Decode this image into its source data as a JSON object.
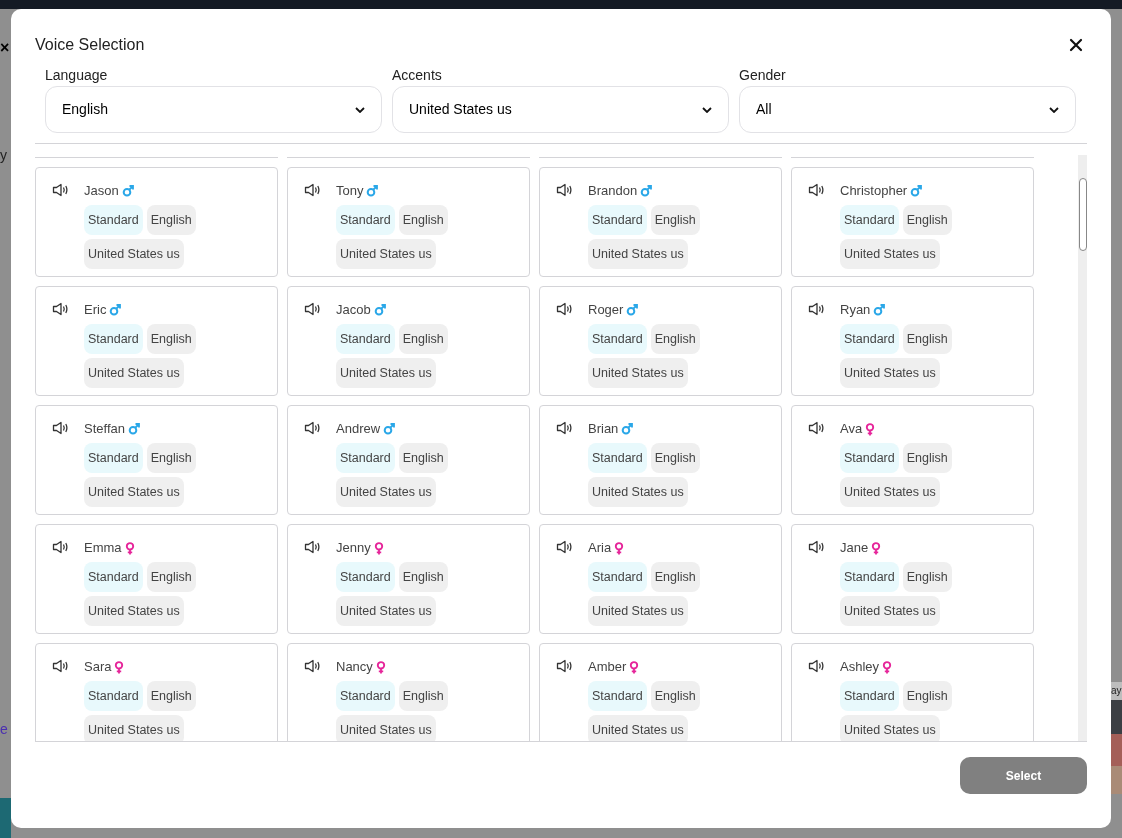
{
  "background": {
    "left_texts": [
      "×",
      "y",
      "e"
    ],
    "right_texts": [
      "ay"
    ]
  },
  "dialog": {
    "title": "Voice Selection"
  },
  "filters": [
    {
      "label": "Language",
      "value": "English"
    },
    {
      "label": "Accents",
      "value": "United States us"
    },
    {
      "label": "Gender",
      "value": "All"
    }
  ],
  "voices": [
    {
      "name": "Jason",
      "kind": "male",
      "tags": [
        {
          "kind": "model",
          "text": "Standard"
        },
        {
          "kind": "info",
          "text": "English"
        },
        {
          "kind": "info",
          "text": "United States us"
        }
      ]
    },
    {
      "name": "Tony",
      "kind": "male",
      "tags": [
        {
          "kind": "model",
          "text": "Standard"
        },
        {
          "kind": "info",
          "text": "English"
        },
        {
          "kind": "info",
          "text": "United States us"
        }
      ]
    },
    {
      "name": "Brandon",
      "kind": "male",
      "tags": [
        {
          "kind": "model",
          "text": "Standard"
        },
        {
          "kind": "info",
          "text": "English"
        },
        {
          "kind": "info",
          "text": "United States us"
        }
      ]
    },
    {
      "name": "Christopher",
      "kind": "male",
      "tags": [
        {
          "kind": "model",
          "text": "Standard"
        },
        {
          "kind": "info",
          "text": "English"
        },
        {
          "kind": "info",
          "text": "United States us"
        }
      ]
    },
    {
      "name": "Eric",
      "kind": "male",
      "tags": [
        {
          "kind": "model",
          "text": "Standard"
        },
        {
          "kind": "info",
          "text": "English"
        },
        {
          "kind": "info",
          "text": "United States us"
        }
      ]
    },
    {
      "name": "Jacob",
      "kind": "male",
      "tags": [
        {
          "kind": "model",
          "text": "Standard"
        },
        {
          "kind": "info",
          "text": "English"
        },
        {
          "kind": "info",
          "text": "United States us"
        }
      ]
    },
    {
      "name": "Roger",
      "kind": "male",
      "tags": [
        {
          "kind": "model",
          "text": "Standard"
        },
        {
          "kind": "info",
          "text": "English"
        },
        {
          "kind": "info",
          "text": "United States us"
        }
      ]
    },
    {
      "name": "Ryan",
      "kind": "male",
      "tags": [
        {
          "kind": "model",
          "text": "Standard"
        },
        {
          "kind": "info",
          "text": "English"
        },
        {
          "kind": "info",
          "text": "United States us"
        }
      ]
    },
    {
      "name": "Steffan",
      "kind": "male",
      "tags": [
        {
          "kind": "model",
          "text": "Standard"
        },
        {
          "kind": "info",
          "text": "English"
        },
        {
          "kind": "info",
          "text": "United States us"
        }
      ]
    },
    {
      "name": "Andrew",
      "kind": "male",
      "tags": [
        {
          "kind": "model",
          "text": "Standard"
        },
        {
          "kind": "info",
          "text": "English"
        },
        {
          "kind": "info",
          "text": "United States us"
        }
      ]
    },
    {
      "name": "Brian",
      "kind": "male",
      "tags": [
        {
          "kind": "model",
          "text": "Standard"
        },
        {
          "kind": "info",
          "text": "English"
        },
        {
          "kind": "info",
          "text": "United States us"
        }
      ]
    },
    {
      "name": "Ava",
      "kind": "female",
      "tags": [
        {
          "kind": "model",
          "text": "Standard"
        },
        {
          "kind": "info",
          "text": "English"
        },
        {
          "kind": "info",
          "text": "United States us"
        }
      ]
    },
    {
      "name": "Emma",
      "kind": "female",
      "tags": [
        {
          "kind": "model",
          "text": "Standard"
        },
        {
          "kind": "info",
          "text": "English"
        },
        {
          "kind": "info",
          "text": "United States us"
        }
      ]
    },
    {
      "name": "Jenny",
      "kind": "female",
      "tags": [
        {
          "kind": "model",
          "text": "Standard"
        },
        {
          "kind": "info",
          "text": "English"
        },
        {
          "kind": "info",
          "text": "United States us"
        }
      ]
    },
    {
      "name": "Aria",
      "kind": "female",
      "tags": [
        {
          "kind": "model",
          "text": "Standard"
        },
        {
          "kind": "info",
          "text": "English"
        },
        {
          "kind": "info",
          "text": "United States us"
        }
      ]
    },
    {
      "name": "Jane",
      "kind": "female",
      "tags": [
        {
          "kind": "model",
          "text": "Standard"
        },
        {
          "kind": "info",
          "text": "English"
        },
        {
          "kind": "info",
          "text": "United States us"
        }
      ]
    },
    {
      "name": "Sara",
      "kind": "female",
      "tags": [
        {
          "kind": "model",
          "text": "Standard"
        },
        {
          "kind": "info",
          "text": "English"
        },
        {
          "kind": "info",
          "text": "United States us"
        }
      ]
    },
    {
      "name": "Nancy",
      "kind": "female",
      "tags": [
        {
          "kind": "model",
          "text": "Standard"
        },
        {
          "kind": "info",
          "text": "English"
        },
        {
          "kind": "info",
          "text": "United States us"
        }
      ]
    },
    {
      "name": "Amber",
      "kind": "female",
      "tags": [
        {
          "kind": "model",
          "text": "Standard"
        },
        {
          "kind": "info",
          "text": "English"
        },
        {
          "kind": "info",
          "text": "United States us"
        }
      ]
    },
    {
      "name": "Ashley",
      "kind": "female",
      "tags": [
        {
          "kind": "model",
          "text": "Standard"
        },
        {
          "kind": "info",
          "text": "English"
        },
        {
          "kind": "info",
          "text": "United States us"
        }
      ]
    }
  ],
  "footer": {
    "button": "Select"
  }
}
